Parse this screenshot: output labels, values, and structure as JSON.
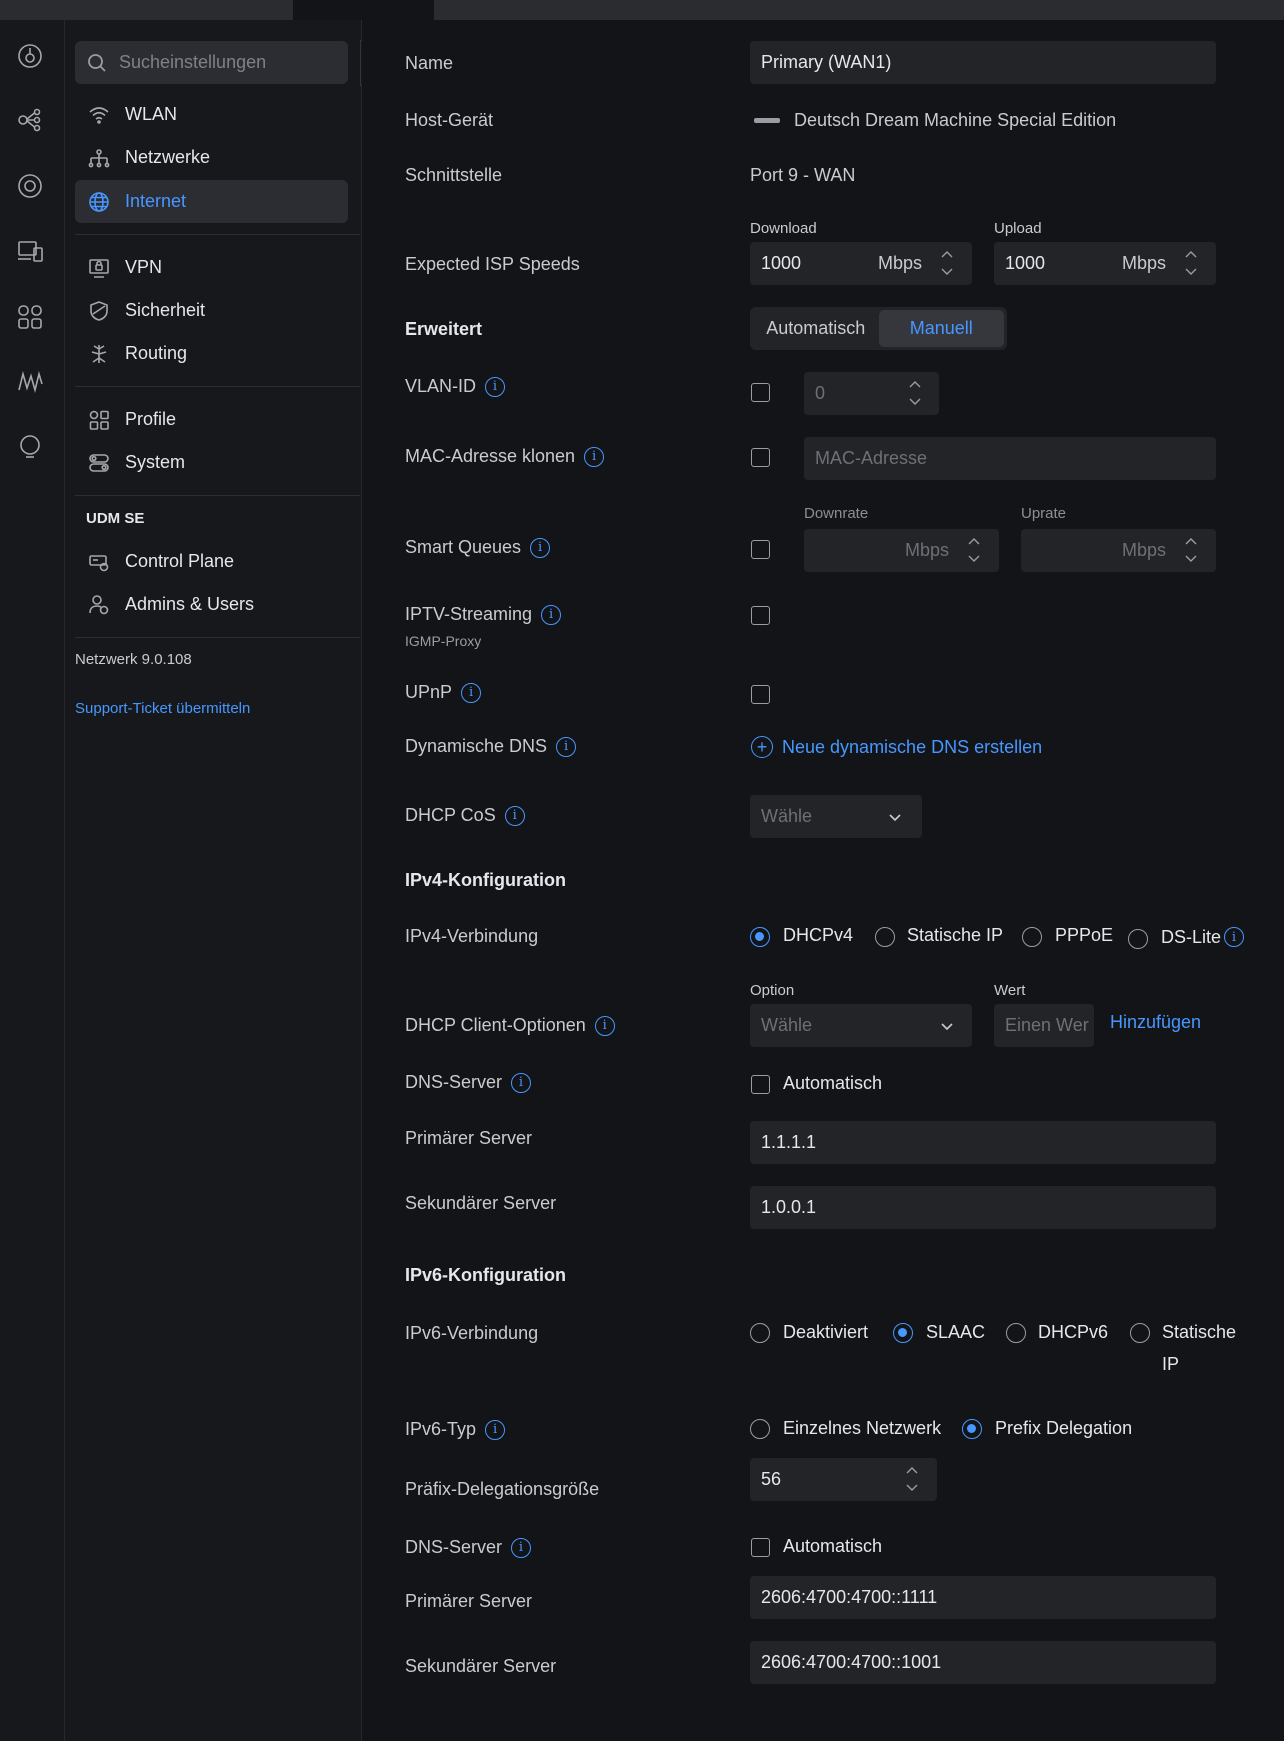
{
  "sidebar": {
    "search_placeholder": "Sucheinstellungen",
    "items": [
      {
        "label": "WLAN"
      },
      {
        "label": "Netzwerke"
      },
      {
        "label": "Internet"
      },
      {
        "label": "VPN"
      },
      {
        "label": "Sicherheit"
      },
      {
        "label": "Routing"
      },
      {
        "label": "Profile"
      },
      {
        "label": "System"
      }
    ],
    "device_section": "UDM SE",
    "device_items": [
      {
        "label": "Control Plane"
      },
      {
        "label": "Admins & Users"
      }
    ],
    "version": "Netzwerk 9.0.108",
    "support_link": "Support-Ticket übermitteln"
  },
  "form": {
    "name_label": "Name",
    "name_value": "Primary (WAN1)",
    "host_label": "Host-Gerät",
    "host_value": "Deutsch Dream Machine Special Edition",
    "interface_label": "Schnittstelle",
    "interface_value": "Port 9 - WAN",
    "isp_label": "Expected ISP Speeds",
    "download_label": "Download",
    "download_value": "1000",
    "upload_label": "Upload",
    "upload_value": "1000",
    "unit": "Mbps",
    "advanced_label": "Erweitert",
    "advanced_options": [
      "Automatisch",
      "Manuell"
    ],
    "advanced_selected": "Manuell",
    "vlan_label": "VLAN-ID",
    "vlan_placeholder": "0",
    "mac_label": "MAC-Adresse klonen",
    "mac_placeholder": "MAC-Adresse",
    "smartq_label": "Smart Queues",
    "downrate_label": "Downrate",
    "uprate_label": "Uprate",
    "iptv_label": "IPTV-Streaming",
    "iptv_sub": "IGMP-Proxy",
    "upnp_label": "UPnP",
    "ddns_label": "Dynamische DNS",
    "ddns_link": "Neue dynamische DNS erstellen",
    "dhcpcos_label": "DHCP CoS",
    "select_placeholder": "Wähle",
    "ipv4_section": "IPv4-Konfiguration",
    "ipv4_conn_label": "IPv4-Verbindung",
    "ipv4_options": [
      "DHCPv4",
      "Statische IP",
      "PPPoE",
      "DS-Lite"
    ],
    "ipv4_selected": "DHCPv4",
    "dhcp_opts_label": "DHCP Client-Optionen",
    "option_label": "Option",
    "wert_label": "Wert",
    "wert_placeholder": "Einen Wer",
    "add_link": "Hinzufügen",
    "dns4_label": "DNS-Server",
    "auto_label": "Automatisch",
    "primary_label": "Primärer Server",
    "primary4_value": "1.1.1.1",
    "secondary_label": "Sekundärer Server",
    "secondary4_value": "1.0.0.1",
    "ipv6_section": "IPv6-Konfiguration",
    "ipv6_conn_label": "IPv6-Verbindung",
    "ipv6_options": [
      "Deaktiviert",
      "SLAAC",
      "DHCPv6",
      "Statische",
      "IP"
    ],
    "ipv6_selected": "SLAAC",
    "ipv6_type_label": "IPv6-Typ",
    "ipv6_type_options": [
      "Einzelnes Netzwerk",
      "Prefix Delegation"
    ],
    "ipv6_type_selected": "Prefix Delegation",
    "prefix_label": "Präfix-Delegationsgröße",
    "prefix_value": "56",
    "dns6_label": "DNS-Server",
    "primary6_value": "2606:4700:4700::1111",
    "secondary6_value": "2606:4700:4700::1001"
  },
  "colors": {
    "accent": "#4797ff",
    "background": "#131417",
    "sidebar": "#17181b",
    "input": "#232428"
  }
}
